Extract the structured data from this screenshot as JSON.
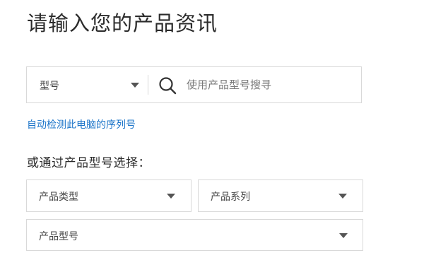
{
  "page": {
    "title": "请输入您的产品资讯"
  },
  "search": {
    "type_select_label": "型号",
    "placeholder": "使用产品型号搜寻",
    "value": ""
  },
  "auto_detect": {
    "link_text": "自动检测此电脑的序列号",
    "link_color": "#1b74c9"
  },
  "selection": {
    "label": "或通过产品型号选择：",
    "dropdowns": {
      "product_type": "产品类型",
      "product_series": "产品系列",
      "product_model": "产品型号"
    }
  },
  "icons": {
    "search": "search-icon",
    "caret": "chevron-down-icon"
  }
}
